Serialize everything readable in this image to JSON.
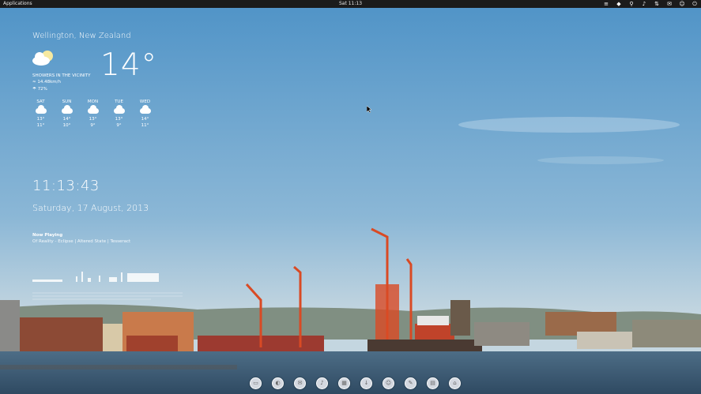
{
  "topbar": {
    "applications_label": "Applications",
    "clock": "Sat 11:13",
    "tray_icons": [
      "menu-icon",
      "dropbox-icon",
      "search-icon",
      "volume-icon",
      "network-icon",
      "mail-icon",
      "user-icon",
      "power-icon"
    ]
  },
  "weather": {
    "location": "Wellington, New Zealand",
    "temperature": "14°",
    "condition": "SHOWERS IN THE VICINITY",
    "wind": "14.48km/h",
    "humidity": "72%",
    "forecast": [
      {
        "day": "SAT",
        "high": "13°",
        "low": "11°",
        "icon": "rain-cloud-icon"
      },
      {
        "day": "SUN",
        "high": "14°",
        "low": "10°",
        "icon": "rain-cloud-icon"
      },
      {
        "day": "MON",
        "high": "13°",
        "low": "9°",
        "icon": "rain-cloud-icon"
      },
      {
        "day": "TUE",
        "high": "13°",
        "low": "9°",
        "icon": "cloud-icon"
      },
      {
        "day": "WED",
        "high": "14°",
        "low": "11°",
        "icon": "cloud-icon"
      }
    ]
  },
  "clock": {
    "time": "11:13:43",
    "date": "Saturday, 17 August, 2013"
  },
  "music": {
    "now_playing_label": "Now Playing",
    "track_line": "Of Reality - Eclipse | Altered State | Tesseract"
  },
  "dock": {
    "items": [
      "files-icon",
      "browser-icon",
      "mail-icon",
      "music-icon",
      "photos-icon",
      "software-icon",
      "contacts-icon",
      "settings-icon",
      "calendar-icon",
      "terminal-icon"
    ]
  },
  "colors": {
    "topbar": "#1b1b1b",
    "sky_top": "#4f93c7",
    "sky_bottom": "#c4d6e0",
    "water": "#3d5a72",
    "crane": "#d94a24"
  }
}
